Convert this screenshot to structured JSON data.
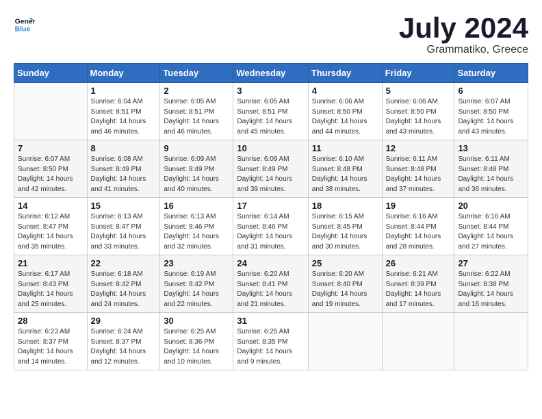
{
  "logo": {
    "line1": "General",
    "line2": "Blue"
  },
  "title": "July 2024",
  "location": "Grammatiko, Greece",
  "header": {
    "days": [
      "Sunday",
      "Monday",
      "Tuesday",
      "Wednesday",
      "Thursday",
      "Friday",
      "Saturday"
    ]
  },
  "weeks": [
    [
      {
        "num": "",
        "info": ""
      },
      {
        "num": "1",
        "info": "Sunrise: 6:04 AM\nSunset: 8:51 PM\nDaylight: 14 hours\nand 46 minutes."
      },
      {
        "num": "2",
        "info": "Sunrise: 6:05 AM\nSunset: 8:51 PM\nDaylight: 14 hours\nand 46 minutes."
      },
      {
        "num": "3",
        "info": "Sunrise: 6:05 AM\nSunset: 8:51 PM\nDaylight: 14 hours\nand 45 minutes."
      },
      {
        "num": "4",
        "info": "Sunrise: 6:06 AM\nSunset: 8:50 PM\nDaylight: 14 hours\nand 44 minutes."
      },
      {
        "num": "5",
        "info": "Sunrise: 6:06 AM\nSunset: 8:50 PM\nDaylight: 14 hours\nand 43 minutes."
      },
      {
        "num": "6",
        "info": "Sunrise: 6:07 AM\nSunset: 8:50 PM\nDaylight: 14 hours\nand 43 minutes."
      }
    ],
    [
      {
        "num": "7",
        "info": "Sunrise: 6:07 AM\nSunset: 8:50 PM\nDaylight: 14 hours\nand 42 minutes."
      },
      {
        "num": "8",
        "info": "Sunrise: 6:08 AM\nSunset: 8:49 PM\nDaylight: 14 hours\nand 41 minutes."
      },
      {
        "num": "9",
        "info": "Sunrise: 6:09 AM\nSunset: 8:49 PM\nDaylight: 14 hours\nand 40 minutes."
      },
      {
        "num": "10",
        "info": "Sunrise: 6:09 AM\nSunset: 8:49 PM\nDaylight: 14 hours\nand 39 minutes."
      },
      {
        "num": "11",
        "info": "Sunrise: 6:10 AM\nSunset: 8:48 PM\nDaylight: 14 hours\nand 38 minutes."
      },
      {
        "num": "12",
        "info": "Sunrise: 6:11 AM\nSunset: 8:48 PM\nDaylight: 14 hours\nand 37 minutes."
      },
      {
        "num": "13",
        "info": "Sunrise: 6:11 AM\nSunset: 8:48 PM\nDaylight: 14 hours\nand 36 minutes."
      }
    ],
    [
      {
        "num": "14",
        "info": "Sunrise: 6:12 AM\nSunset: 8:47 PM\nDaylight: 14 hours\nand 35 minutes."
      },
      {
        "num": "15",
        "info": "Sunrise: 6:13 AM\nSunset: 8:47 PM\nDaylight: 14 hours\nand 33 minutes."
      },
      {
        "num": "16",
        "info": "Sunrise: 6:13 AM\nSunset: 8:46 PM\nDaylight: 14 hours\nand 32 minutes."
      },
      {
        "num": "17",
        "info": "Sunrise: 6:14 AM\nSunset: 8:46 PM\nDaylight: 14 hours\nand 31 minutes."
      },
      {
        "num": "18",
        "info": "Sunrise: 6:15 AM\nSunset: 8:45 PM\nDaylight: 14 hours\nand 30 minutes."
      },
      {
        "num": "19",
        "info": "Sunrise: 6:16 AM\nSunset: 8:44 PM\nDaylight: 14 hours\nand 28 minutes."
      },
      {
        "num": "20",
        "info": "Sunrise: 6:16 AM\nSunset: 8:44 PM\nDaylight: 14 hours\nand 27 minutes."
      }
    ],
    [
      {
        "num": "21",
        "info": "Sunrise: 6:17 AM\nSunset: 8:43 PM\nDaylight: 14 hours\nand 25 minutes."
      },
      {
        "num": "22",
        "info": "Sunrise: 6:18 AM\nSunset: 8:42 PM\nDaylight: 14 hours\nand 24 minutes."
      },
      {
        "num": "23",
        "info": "Sunrise: 6:19 AM\nSunset: 8:42 PM\nDaylight: 14 hours\nand 22 minutes."
      },
      {
        "num": "24",
        "info": "Sunrise: 6:20 AM\nSunset: 8:41 PM\nDaylight: 14 hours\nand 21 minutes."
      },
      {
        "num": "25",
        "info": "Sunrise: 6:20 AM\nSunset: 8:40 PM\nDaylight: 14 hours\nand 19 minutes."
      },
      {
        "num": "26",
        "info": "Sunrise: 6:21 AM\nSunset: 8:39 PM\nDaylight: 14 hours\nand 17 minutes."
      },
      {
        "num": "27",
        "info": "Sunrise: 6:22 AM\nSunset: 8:38 PM\nDaylight: 14 hours\nand 16 minutes."
      }
    ],
    [
      {
        "num": "28",
        "info": "Sunrise: 6:23 AM\nSunset: 8:37 PM\nDaylight: 14 hours\nand 14 minutes."
      },
      {
        "num": "29",
        "info": "Sunrise: 6:24 AM\nSunset: 8:37 PM\nDaylight: 14 hours\nand 12 minutes."
      },
      {
        "num": "30",
        "info": "Sunrise: 6:25 AM\nSunset: 8:36 PM\nDaylight: 14 hours\nand 10 minutes."
      },
      {
        "num": "31",
        "info": "Sunrise: 6:25 AM\nSunset: 8:35 PM\nDaylight: 14 hours\nand 9 minutes."
      },
      {
        "num": "",
        "info": ""
      },
      {
        "num": "",
        "info": ""
      },
      {
        "num": "",
        "info": ""
      }
    ]
  ]
}
